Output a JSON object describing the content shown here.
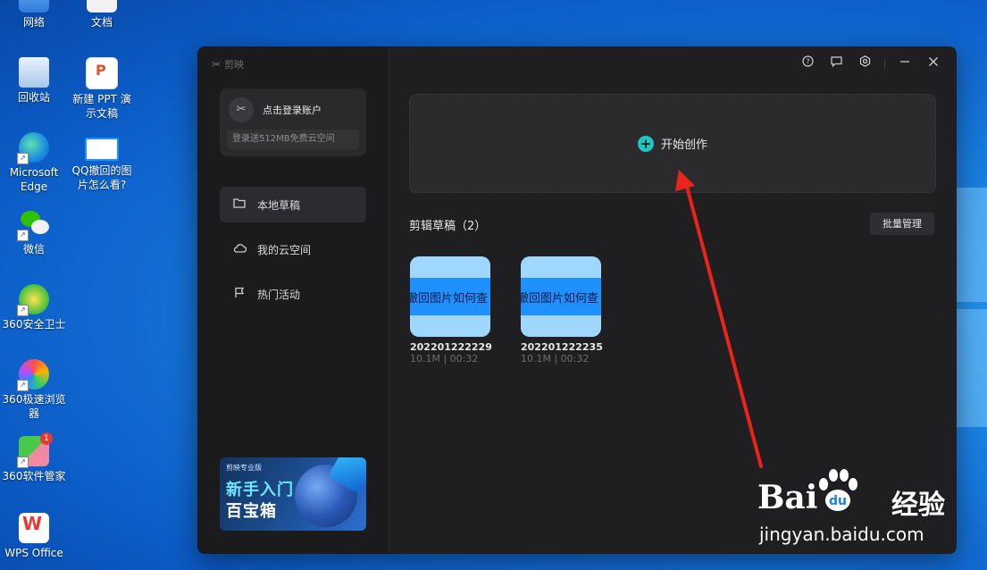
{
  "desktop": {
    "icons": [
      {
        "label": "网络"
      },
      {
        "label": "文档"
      },
      {
        "label": "回收站"
      },
      {
        "label": "新建 PPT 演示文稿"
      },
      {
        "label": "Microsoft Edge"
      },
      {
        "label": "QQ撤回的图片怎么看?"
      },
      {
        "label": "微信"
      },
      {
        "label": "360安全卫士"
      },
      {
        "label": "360极速浏览器"
      },
      {
        "label": "360软件管家",
        "badge": "1"
      },
      {
        "label": "WPS Office"
      }
    ]
  },
  "app": {
    "brand": "剪映",
    "account": {
      "login_label": "点击登录账户",
      "promo": "登录送512MB免费云空间"
    },
    "nav": [
      {
        "label": "本地草稿",
        "icon": "folder-icon",
        "active": true
      },
      {
        "label": "我的云空间",
        "icon": "cloud-icon",
        "active": false
      },
      {
        "label": "热门活动",
        "icon": "flag-icon",
        "active": false
      }
    ],
    "banner": {
      "brandline": "剪映专业版",
      "line1": "新手入门",
      "line2": "百宝箱"
    },
    "toolbar": {
      "help_icon": "help-icon",
      "feedback_icon": "feedback-icon",
      "settings_icon": "settings-icon",
      "minimize_icon": "minimize-icon",
      "close_icon": "close-icon"
    },
    "create": {
      "label": "开始创作"
    },
    "drafts": {
      "title": "剪辑草稿（2）",
      "batch_label": "批量管理",
      "items": [
        {
          "thumb_text": "撤回图片如何查",
          "name": "202201222229",
          "meta": "10.1M | 00:32"
        },
        {
          "thumb_text": "撤回图片如何查",
          "name": "202201222235",
          "meta": "10.1M | 00:32"
        }
      ]
    },
    "accent_color": "#1fc7c3"
  },
  "watermark": {
    "brand": "Bai",
    "brand_cn": "经验",
    "url": "jingyan.baidu.com"
  }
}
